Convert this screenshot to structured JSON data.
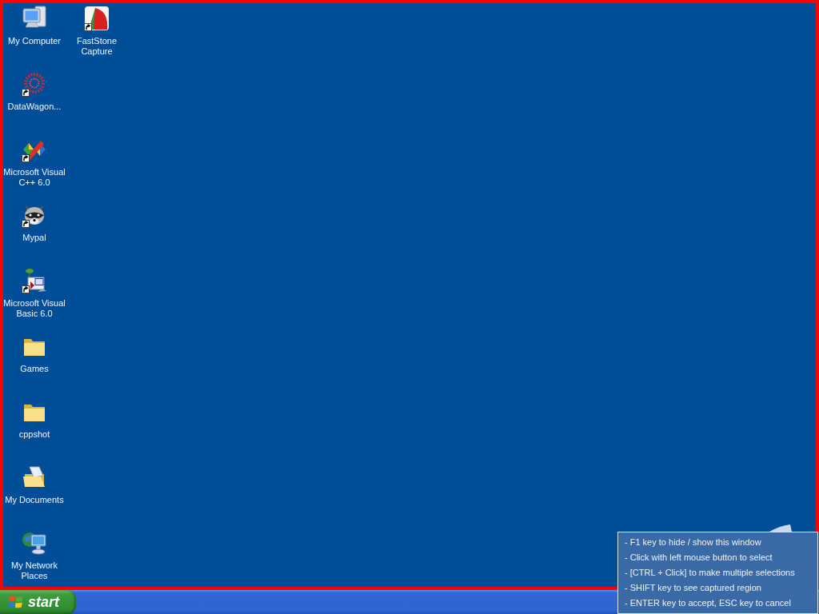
{
  "desktop": {
    "columns": [
      {
        "icons": [
          {
            "kind": "computer",
            "label": "My Computer",
            "shortcut": false
          },
          {
            "kind": "gear",
            "label": "DataWagon...",
            "shortcut": true
          },
          {
            "kind": "vcpp",
            "label": "Microsoft Visual C++ 6.0",
            "shortcut": true
          },
          {
            "kind": "raccoon",
            "label": "Mypal",
            "shortcut": true
          },
          {
            "kind": "vb",
            "label": "Microsoft Visual Basic 6.0",
            "shortcut": true
          },
          {
            "kind": "folder",
            "label": "Games",
            "shortcut": false
          },
          {
            "kind": "folder",
            "label": "cppshot",
            "shortcut": false
          },
          {
            "kind": "documents",
            "label": "My Documents",
            "shortcut": false
          },
          {
            "kind": "network",
            "label": "My Network Places",
            "shortcut": false
          }
        ]
      },
      {
        "icons": [
          {
            "kind": "capture",
            "label": "FastStone Capture",
            "shortcut": true
          }
        ]
      }
    ]
  },
  "taskbar": {
    "start_button": {
      "label": "start"
    }
  },
  "capture_hints": {
    "lines": [
      "- F1 key to hide / show this window",
      "- Click with left mouse button to select",
      "- [CTRL + Click] to make multiple selections",
      "- SHIFT key to see captured region",
      "- ENTER key to accept, ESC key to cancel"
    ]
  }
}
